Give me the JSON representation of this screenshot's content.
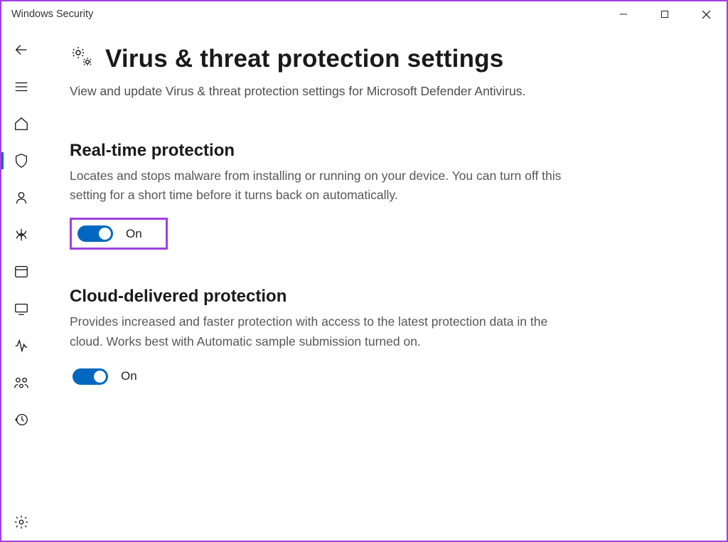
{
  "window": {
    "title": "Windows Security"
  },
  "page": {
    "heading": "Virus & threat protection settings",
    "description": "View and update Virus & threat protection settings for Microsoft Defender Antivirus."
  },
  "sections": {
    "realtime": {
      "title": "Real-time protection",
      "description": "Locates and stops malware from installing or running on your device. You can turn off this setting for a short time before it turns back on automatically.",
      "toggle_label": "On",
      "toggle_on": true
    },
    "cloud": {
      "title": "Cloud-delivered protection",
      "description": "Provides increased and faster protection with access to the latest protection data in the cloud. Works best with Automatic sample submission turned on.",
      "toggle_label": "On",
      "toggle_on": true
    }
  },
  "colors": {
    "accent": "#0067c0",
    "highlight": "#a040e0"
  }
}
